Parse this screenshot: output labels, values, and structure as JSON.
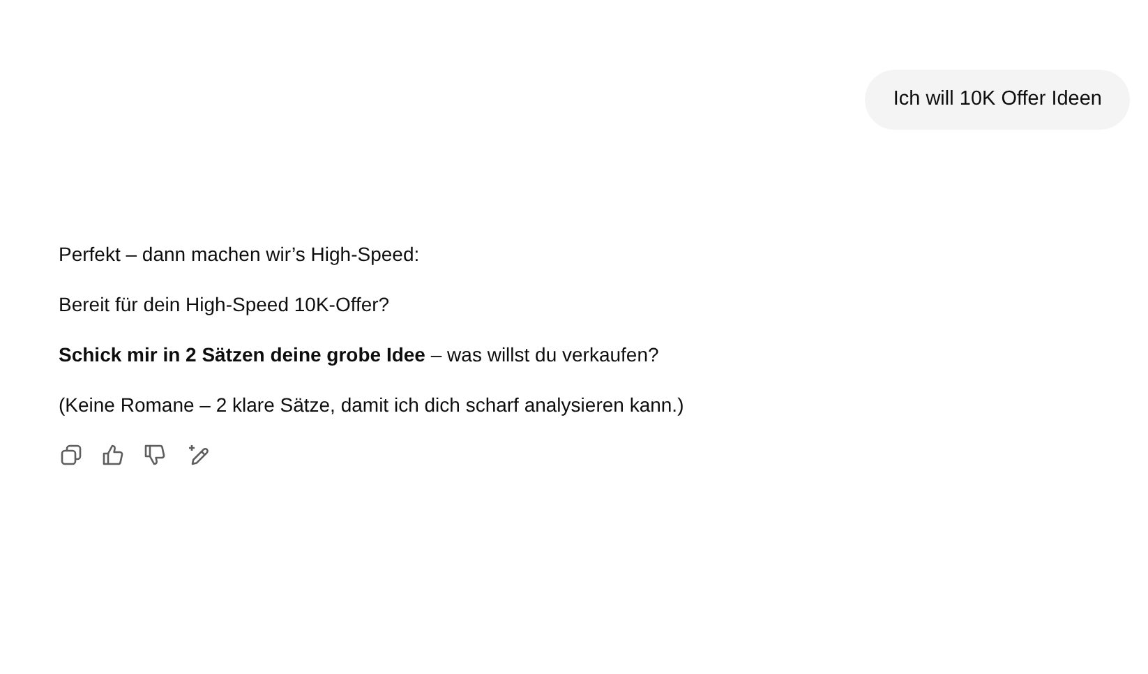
{
  "user_message": {
    "text": "Ich will 10K Offer Ideen"
  },
  "assistant_message": {
    "paragraphs": [
      "Perfekt – dann machen wir’s High-Speed:",
      "Bereit für dein High-Speed 10K-Offer?",
      "**Schick mir in 2 Sätzen deine grobe Idee** – was willst du verkaufen?",
      "(Keine Romane – 2 klare Sätze, damit ich dich scharf analysieren kann.)"
    ]
  }
}
